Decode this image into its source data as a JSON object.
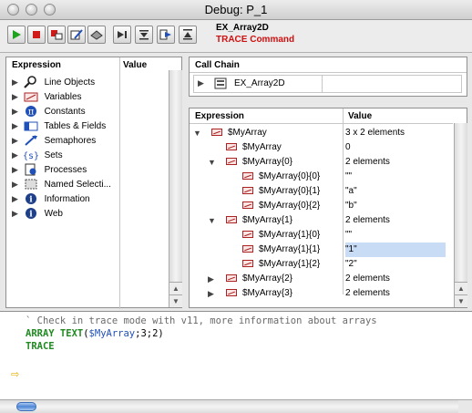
{
  "window": {
    "title": "Debug: P_1"
  },
  "toolbar": {
    "buttons": [
      "run-icon",
      "abort-icon",
      "abort-and-edit-icon",
      "edit-icon",
      "step-over-icon",
      "step-into-icon",
      "step-out-icon",
      "trace-icon",
      "call-icon"
    ],
    "method_name": "EX_Array2D",
    "mode_label": "TRACE Command"
  },
  "expression_pane": {
    "col_expression": "Expression",
    "col_value": "Value",
    "items": [
      {
        "label": "Line Objects",
        "icon": "magnifier-icon"
      },
      {
        "label": "Variables",
        "icon": "array-icon"
      },
      {
        "label": "Constants",
        "icon": "pi-icon"
      },
      {
        "label": "Tables & Fields",
        "icon": "table-icon"
      },
      {
        "label": "Semaphores",
        "icon": "semaphore-icon"
      },
      {
        "label": "Sets",
        "icon": "set-icon"
      },
      {
        "label": "Processes",
        "icon": "process-icon"
      },
      {
        "label": "Named Selecti...",
        "icon": "selection-icon"
      },
      {
        "label": "Information",
        "icon": "info-icon"
      },
      {
        "label": "Web",
        "icon": "web-icon"
      }
    ]
  },
  "call_chain": {
    "header": "Call Chain",
    "method": "EX_Array2D"
  },
  "watch_pane": {
    "col_expression": "Expression",
    "col_value": "Value",
    "rows": [
      {
        "name": "$MyArray",
        "value": "3 x 2 elements"
      },
      {
        "name": "$MyArray",
        "value": "0"
      },
      {
        "name": "$MyArray{0}",
        "value": "2 elements"
      },
      {
        "name": "$MyArray{0}{0}",
        "value": "\"\""
      },
      {
        "name": "$MyArray{0}{1}",
        "value": "\"a\""
      },
      {
        "name": "$MyArray{0}{2}",
        "value": "\"b\""
      },
      {
        "name": "$MyArray{1}",
        "value": "2 elements"
      },
      {
        "name": "$MyArray{1}{0}",
        "value": "\"\""
      },
      {
        "name": "$MyArray{1}{1}",
        "value": "\"1\""
      },
      {
        "name": "$MyArray{1}{2}",
        "value": "\"2\""
      },
      {
        "name": "$MyArray{2}",
        "value": "2 elements"
      },
      {
        "name": "$MyArray{3}",
        "value": "2 elements"
      }
    ]
  },
  "code": {
    "comment": "` Check in trace mode with v11, more information about arrays",
    "line2_kw": "ARRAY TEXT",
    "line2_open": "(",
    "line2_var": "$MyArray",
    "line2_args": ";3;2)",
    "line3_kw": "TRACE"
  }
}
